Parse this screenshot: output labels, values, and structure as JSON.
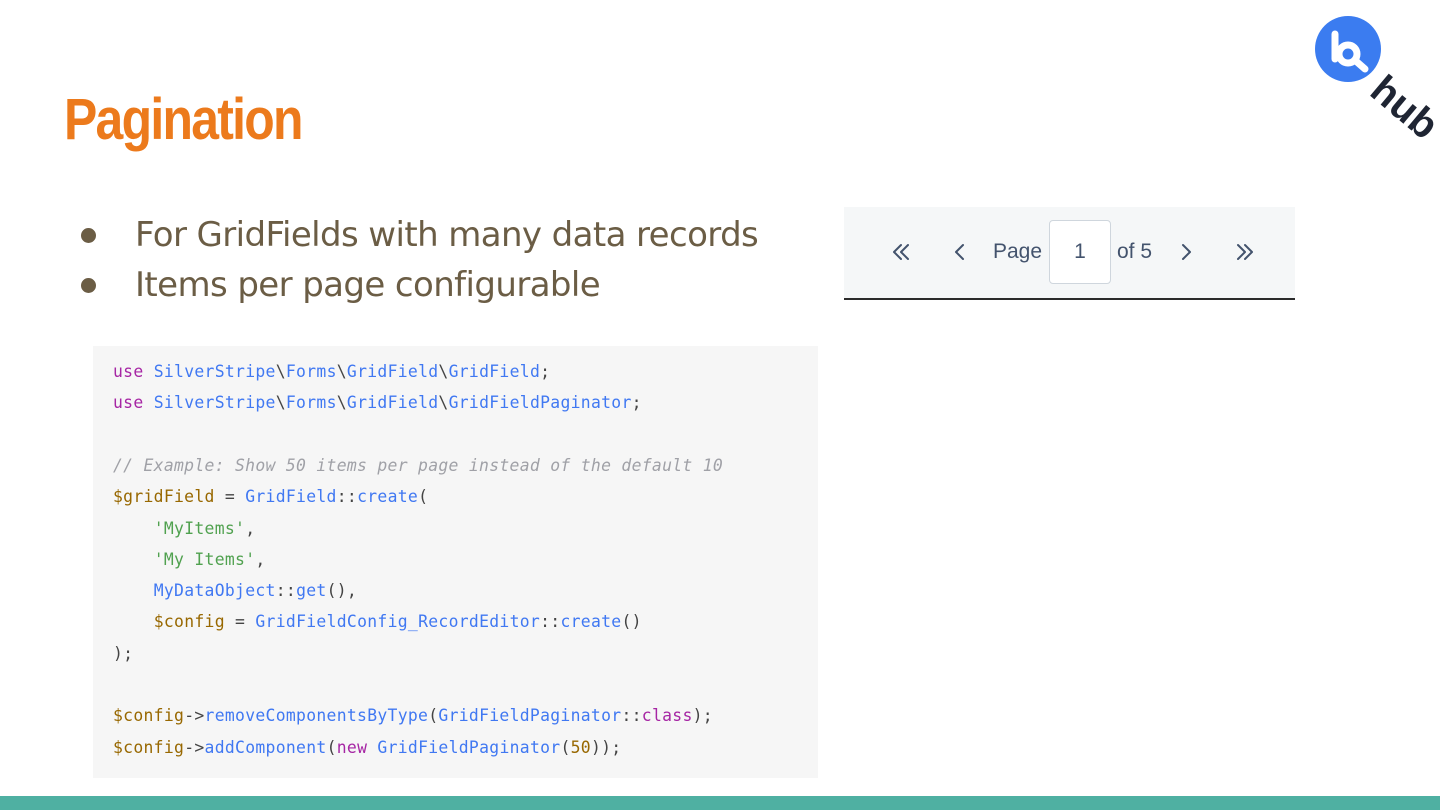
{
  "slide": {
    "title": "Pagination",
    "title_color": "#ec7a1c",
    "accent_bar_color": "#4fb0a2"
  },
  "logo": {
    "text": "hub",
    "icon": "hub-logo"
  },
  "bullets": [
    "For GridFields with many data records",
    "Items per page configurable"
  ],
  "pager": {
    "first_icon": "double-chevron-left-icon",
    "prev_icon": "chevron-left-icon",
    "page_label": "Page",
    "current_page": "1",
    "of_label": "of 5",
    "next_icon": "chevron-right-icon",
    "last_icon": "double-chevron-right-icon"
  },
  "code_lines": [
    [
      [
        "kw",
        "use"
      ],
      [
        "pun",
        " "
      ],
      [
        "cls",
        "SilverStripe"
      ],
      [
        "pun",
        "\\"
      ],
      [
        "cls",
        "Forms"
      ],
      [
        "pun",
        "\\"
      ],
      [
        "cls",
        "GridField"
      ],
      [
        "pun",
        "\\"
      ],
      [
        "cls",
        "GridField"
      ],
      [
        "pun",
        ";"
      ]
    ],
    [
      [
        "kw",
        "use"
      ],
      [
        "pun",
        " "
      ],
      [
        "cls",
        "SilverStripe"
      ],
      [
        "pun",
        "\\"
      ],
      [
        "cls",
        "Forms"
      ],
      [
        "pun",
        "\\"
      ],
      [
        "cls",
        "GridField"
      ],
      [
        "pun",
        "\\"
      ],
      [
        "cls",
        "GridFieldPaginator"
      ],
      [
        "pun",
        ";"
      ]
    ],
    [],
    [
      [
        "com",
        "// Example: Show 50 items per page instead of the default 10"
      ]
    ],
    [
      [
        "var",
        "$gridField"
      ],
      [
        "pun",
        " = "
      ],
      [
        "cls",
        "GridField"
      ],
      [
        "pun",
        "::"
      ],
      [
        "fn",
        "create"
      ],
      [
        "pun",
        "("
      ]
    ],
    [
      [
        "pun",
        "    "
      ],
      [
        "str",
        "'MyItems'"
      ],
      [
        "pun",
        ","
      ]
    ],
    [
      [
        "pun",
        "    "
      ],
      [
        "str",
        "'My Items'"
      ],
      [
        "pun",
        ","
      ]
    ],
    [
      [
        "pun",
        "    "
      ],
      [
        "cls",
        "MyDataObject"
      ],
      [
        "pun",
        "::"
      ],
      [
        "fn",
        "get"
      ],
      [
        "pun",
        "(),"
      ]
    ],
    [
      [
        "pun",
        "    "
      ],
      [
        "var",
        "$config"
      ],
      [
        "pun",
        " = "
      ],
      [
        "cls",
        "GridFieldConfig_RecordEditor"
      ],
      [
        "pun",
        "::"
      ],
      [
        "fn",
        "create"
      ],
      [
        "pun",
        "()"
      ]
    ],
    [
      [
        "pun",
        ");"
      ]
    ],
    [],
    [
      [
        "var",
        "$config"
      ],
      [
        "pun",
        "->"
      ],
      [
        "fn",
        "removeComponentsByType"
      ],
      [
        "pun",
        "("
      ],
      [
        "cls",
        "GridFieldPaginator"
      ],
      [
        "pun",
        "::"
      ],
      [
        "kw",
        "class"
      ],
      [
        "pun",
        ");"
      ]
    ],
    [
      [
        "var",
        "$config"
      ],
      [
        "pun",
        "->"
      ],
      [
        "fn",
        "addComponent"
      ],
      [
        "pun",
        "("
      ],
      [
        "kw",
        "new"
      ],
      [
        "pun",
        " "
      ],
      [
        "cls",
        "GridFieldPaginator"
      ],
      [
        "pun",
        "("
      ],
      [
        "num",
        "50"
      ],
      [
        "pun",
        "));"
      ]
    ]
  ]
}
